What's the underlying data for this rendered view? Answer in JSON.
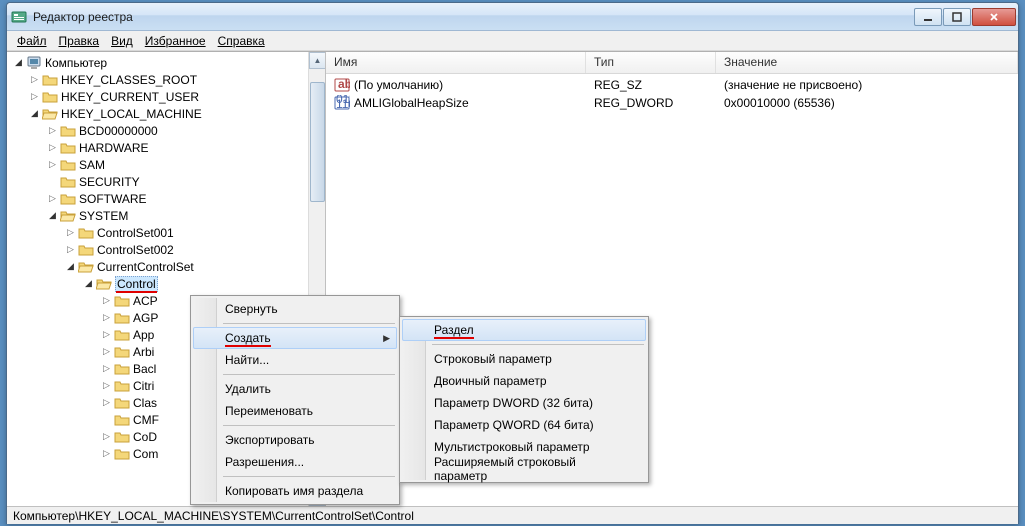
{
  "window": {
    "title": "Редактор реестра"
  },
  "menubar": {
    "file": "Файл",
    "edit": "Правка",
    "view": "Вид",
    "favorites": "Избранное",
    "help": "Справка"
  },
  "tree": {
    "root": "Компьютер",
    "hkcr": "HKEY_CLASSES_ROOT",
    "hkcu": "HKEY_CURRENT_USER",
    "hklm": "HKEY_LOCAL_MACHINE",
    "bcd": "BCD00000000",
    "hardware": "HARDWARE",
    "sam": "SAM",
    "security": "SECURITY",
    "software": "SOFTWARE",
    "system": "SYSTEM",
    "cs001": "ControlSet001",
    "cs002": "ControlSet002",
    "ccs": "CurrentControlSet",
    "control": "Control",
    "acp": "ACP",
    "agp": "AGP",
    "app": "App",
    "arbi": "Arbi",
    "back": "Bacl",
    "citri": "Citri",
    "clas": "Clas",
    "cmf": "CMF",
    "cod": "CoD",
    "com": "Com"
  },
  "list": {
    "col_name": "Имя",
    "col_type": "Тип",
    "col_value": "Значение",
    "rows": [
      {
        "name": "(По умолчанию)",
        "type": "REG_SZ",
        "value": "(значение не присвоено)",
        "icon": "string"
      },
      {
        "name": "AMLIGlobalHeapSize",
        "type": "REG_DWORD",
        "value": "0x00010000 (65536)",
        "icon": "binary"
      }
    ]
  },
  "context1": {
    "collapse": "Свернуть",
    "create": "Создать",
    "find": "Найти...",
    "delete": "Удалить",
    "rename": "Переименовать",
    "export": "Экспортировать",
    "permissions": "Разрешения...",
    "copy_key_name": "Копировать имя раздела"
  },
  "context2": {
    "key": "Раздел",
    "string": "Строковый параметр",
    "binary": "Двоичный параметр",
    "dword": "Параметр DWORD (32 бита)",
    "qword": "Параметр QWORD (64 бита)",
    "multistring": "Мультистроковый параметр",
    "expandstring": "Расширяемый строковый параметр"
  },
  "statusbar": {
    "path": "Компьютер\\HKEY_LOCAL_MACHINE\\SYSTEM\\CurrentControlSet\\Control"
  }
}
